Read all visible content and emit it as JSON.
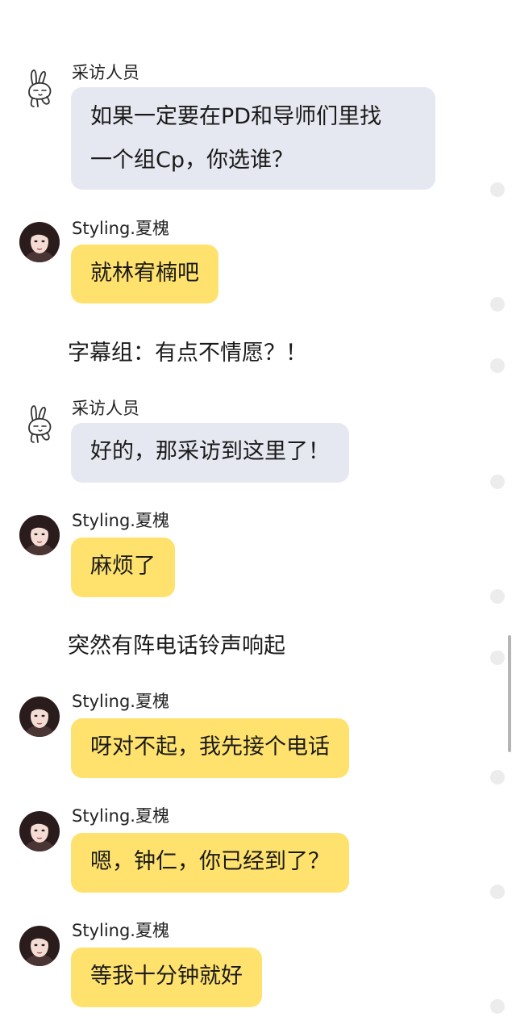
{
  "speakers": {
    "interviewer": "采访人员",
    "guest": "Styling.夏槐"
  },
  "messages": [
    {
      "speaker": "采访人员",
      "line1": "如果一定要在PD和导师们里找",
      "line2": "一个组Cp，你选谁？"
    },
    {
      "speaker": "Styling.夏槐",
      "text": "就林宥楠吧"
    },
    {
      "narration": "字幕组：有点不情愿？！"
    },
    {
      "speaker": "采访人员",
      "text": "好的，那采访到这里了！"
    },
    {
      "speaker": "Styling.夏槐",
      "text": "麻烦了"
    },
    {
      "narration": "突然有阵电话铃声响起"
    },
    {
      "speaker": "Styling.夏槐",
      "text": "呀对不起，我先接个电话"
    },
    {
      "speaker": "Styling.夏槐",
      "text": "嗯，钟仁，你已经到了？"
    },
    {
      "speaker": "Styling.夏槐",
      "text": "等我十分钟就好"
    }
  ],
  "colors": {
    "interviewer_bubble": "#e6e8f1",
    "guest_bubble": "#ffe26d",
    "background": "#ffffff"
  },
  "icons": {
    "interviewer_avatar": "rabbit-doodle-icon",
    "guest_avatar": "profile-photo"
  }
}
